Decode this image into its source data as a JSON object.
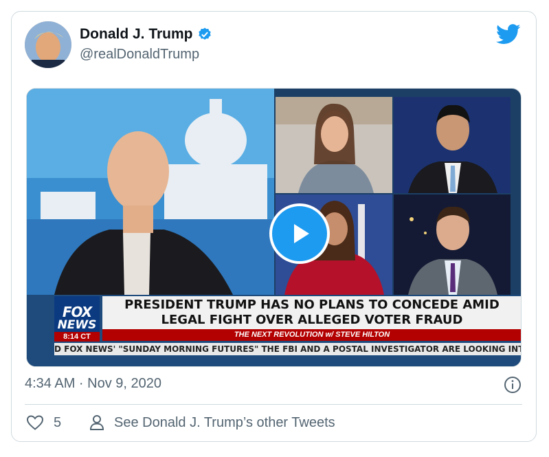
{
  "author": {
    "name": "Donald J. Trump",
    "handle": "@realDonaldTrump",
    "verified": true
  },
  "video": {
    "chyron": {
      "network_line1": "FOX",
      "network_line2": "NEWS",
      "time": "8:14 CT",
      "headline_line1": "PRESIDENT TRUMP HAS NO PLANS TO CONCEDE AMID",
      "headline_line2": "LEGAL FIGHT OVER ALLEGED VOTER FRAUD",
      "show": "THE NEXT REVOLUTION w/ STEVE HILTON",
      "ticker": "D FOX NEWS' \"SUNDAY MORNING FUTURES\" THE FBI AND A POSTAL INVESTIGATOR ARE LOOKING INTO T"
    }
  },
  "footer": {
    "timestamp": "4:34 AM · Nov 9, 2020",
    "like_count": "5",
    "other_tweets_label": "See Donald J. Trump’s other Tweets"
  },
  "colors": {
    "brand": "#1d9bf0",
    "text_secondary": "#536471",
    "border": "#cfd9de"
  },
  "icons": [
    "twitter-bird-icon",
    "verified-badge-icon",
    "play-icon",
    "info-icon",
    "heart-icon",
    "person-icon"
  ]
}
